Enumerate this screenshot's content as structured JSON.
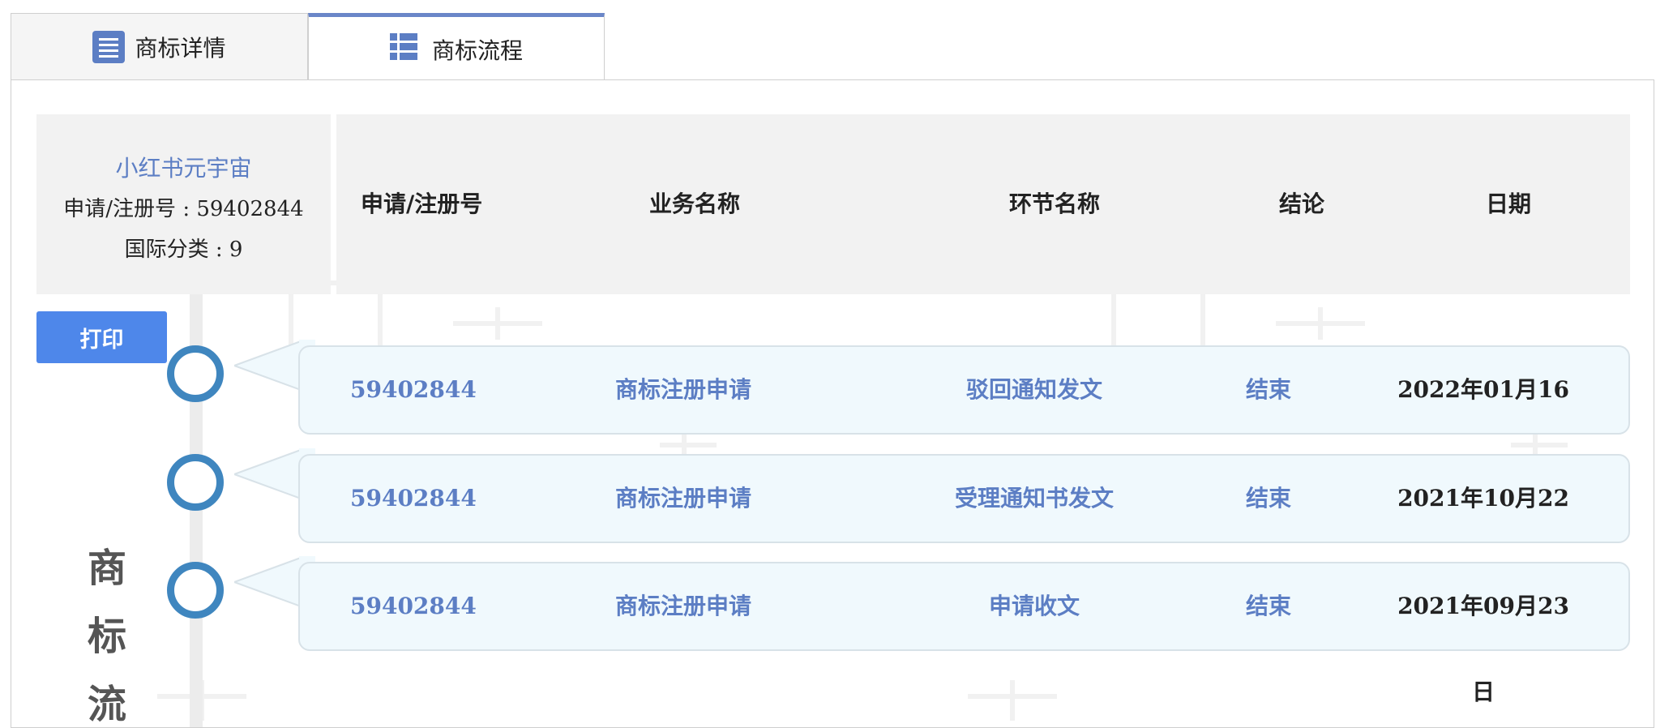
{
  "tabs": [
    {
      "label": "商标详情",
      "icon": "list-icon"
    },
    {
      "label": "商标流程",
      "icon": "grid-list-icon"
    }
  ],
  "info": {
    "name": "小红书元宇宙",
    "reg_no_line": "申请/注册号 : 59402844",
    "class_line": "国际分类 : 9"
  },
  "headers": {
    "reg_no": "申请/注册号",
    "business": "业务名称",
    "stage": "环节名称",
    "result": "结论",
    "date": "日期"
  },
  "print_label": "打印",
  "vertical_label": [
    "商",
    "标",
    "流"
  ],
  "rows": [
    {
      "reg_no": "59402844",
      "business": "商标注册申请",
      "stage": "驳回通知发文",
      "result": "结束",
      "date": "2022年01月16日"
    },
    {
      "reg_no": "59402844",
      "business": "商标注册申请",
      "stage": "受理通知书发文",
      "result": "结束",
      "date": "2021年10月22日"
    },
    {
      "reg_no": "59402844",
      "business": "商标注册申请",
      "stage": "申请收文",
      "result": "结束",
      "date": "2021年09月23日"
    }
  ],
  "colors": {
    "accent": "#6a86c8",
    "link": "#5c7ec4",
    "button": "#4e87ea",
    "timeline_dot": "#3f86bf",
    "row_bg": "#f0f9fd"
  }
}
